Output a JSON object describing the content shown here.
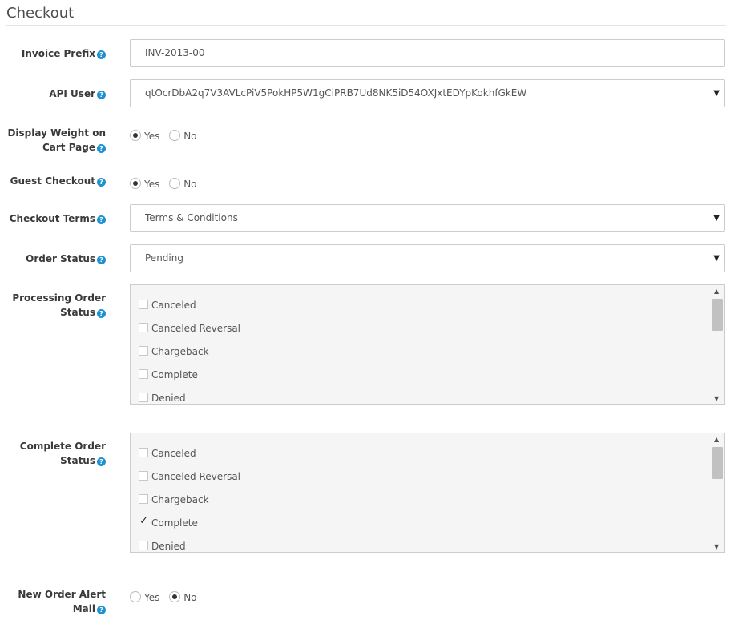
{
  "legend": "Checkout",
  "help_glyph": "?",
  "invoice_prefix": {
    "label": "Invoice Prefix",
    "value": "INV-2013-00"
  },
  "api_user": {
    "label": "API User",
    "value": "qtOcrDbA2q7V3AVLcPiV5PokHP5W1gCiPRB7Ud8NK5iD54OXJxtEDYpKokhfGkEW",
    "arrow": "▼"
  },
  "display_weight": {
    "label_line1": "Display Weight on",
    "label_line2": "Cart Page",
    "yes": "Yes",
    "no": "No",
    "selected": "yes"
  },
  "guest_checkout": {
    "label": "Guest Checkout",
    "yes": "Yes",
    "no": "No",
    "selected": "yes"
  },
  "checkout_terms": {
    "label": "Checkout Terms",
    "value": "Terms & Conditions",
    "arrow": "▼"
  },
  "order_status": {
    "label": "Order Status",
    "value": "Pending",
    "arrow": "▼"
  },
  "processing_status": {
    "label_line1": "Processing Order",
    "label_line2": "Status",
    "items": [
      {
        "label": "Canceled",
        "checked": false
      },
      {
        "label": "Canceled Reversal",
        "checked": false
      },
      {
        "label": "Chargeback",
        "checked": false
      },
      {
        "label": "Complete",
        "checked": false
      },
      {
        "label": "Denied",
        "checked": false
      }
    ]
  },
  "complete_status": {
    "label_line1": "Complete Order",
    "label_line2": "Status",
    "items": [
      {
        "label": "Canceled",
        "checked": false
      },
      {
        "label": "Canceled Reversal",
        "checked": false
      },
      {
        "label": "Chargeback",
        "checked": false
      },
      {
        "label": "Complete",
        "checked": true
      },
      {
        "label": "Denied",
        "checked": false
      }
    ]
  },
  "new_order_alert": {
    "label_line1": "New Order Alert",
    "label_line2": "Mail",
    "yes": "Yes",
    "no": "No",
    "selected": "no"
  },
  "scroll_glyphs": {
    "up": "▲",
    "down": "▼"
  }
}
